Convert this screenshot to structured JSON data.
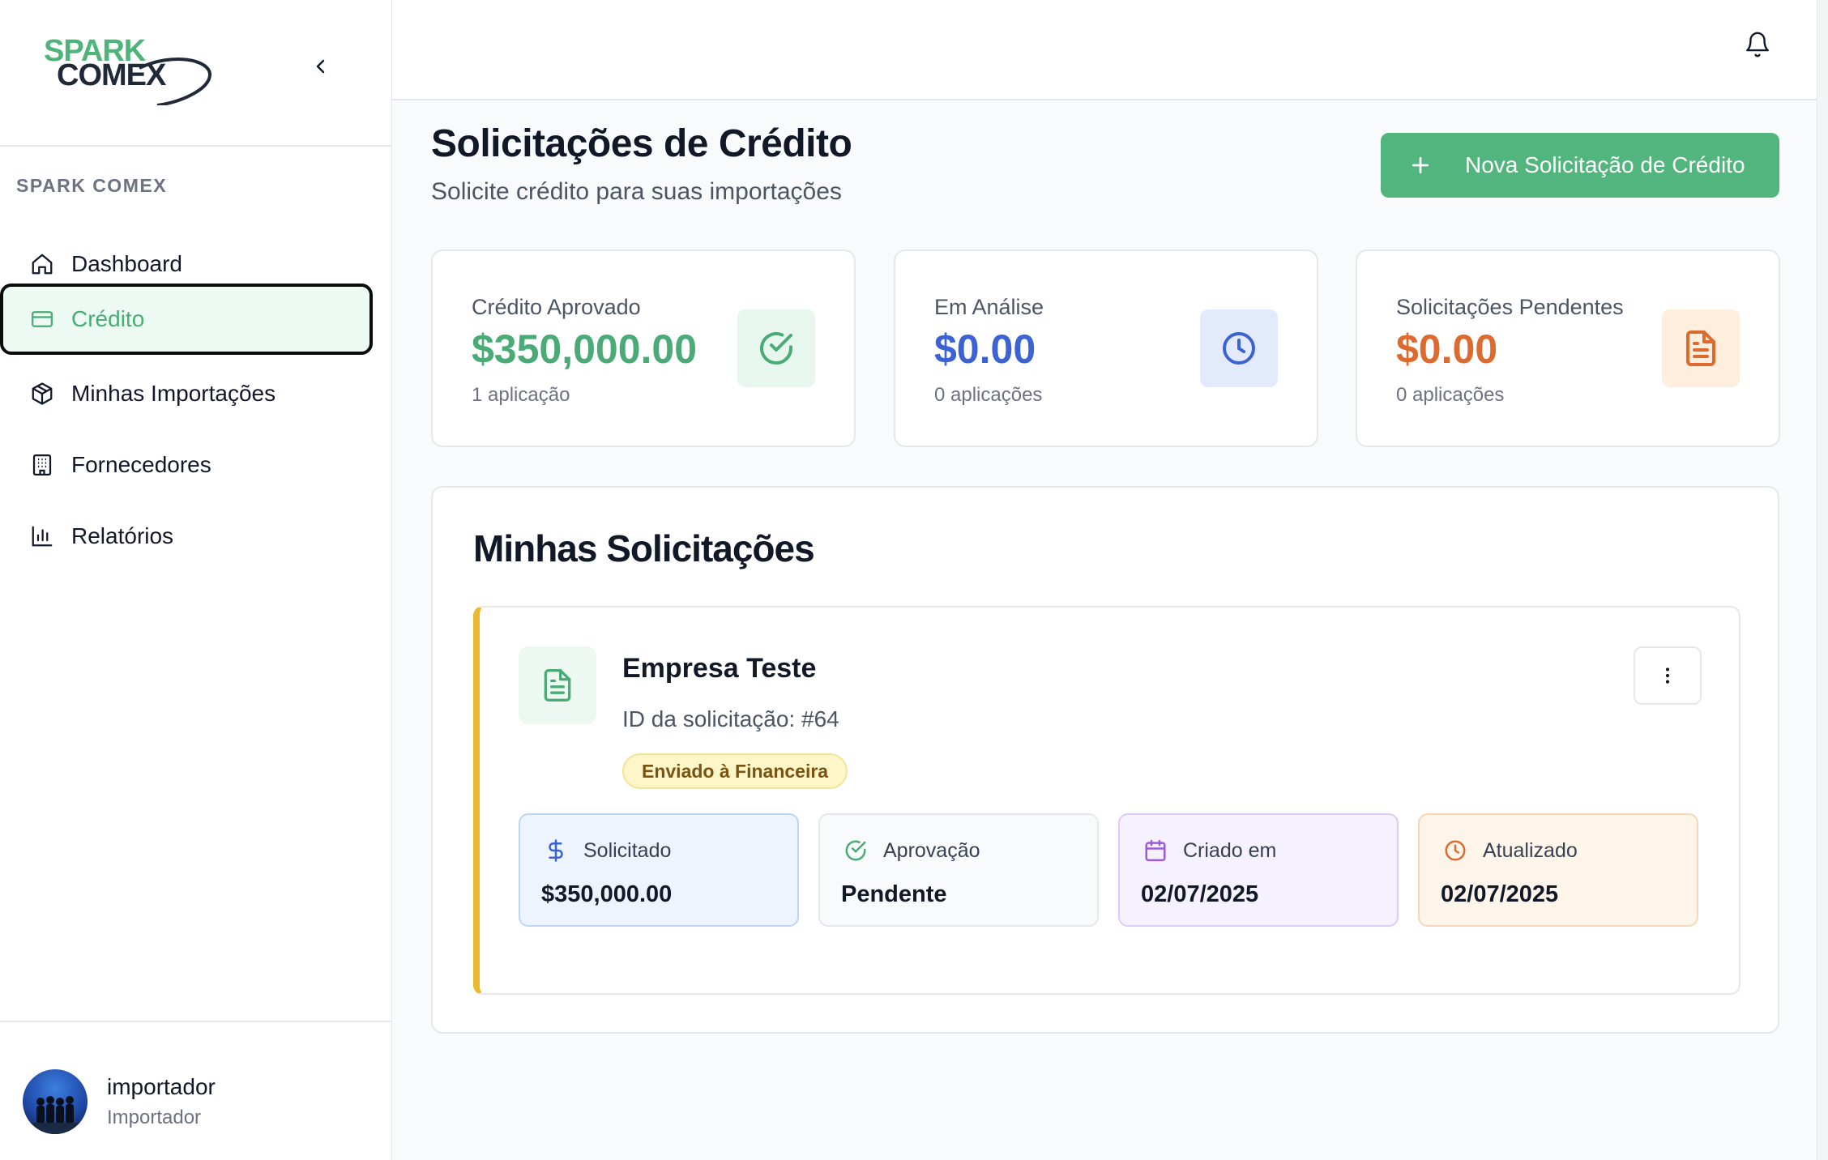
{
  "app": {
    "logo_line1": "SPARK",
    "logo_line2": "COMEX",
    "section_label": "SPARK COMEX"
  },
  "sidebar": {
    "items": [
      {
        "label": "Dashboard",
        "icon": "home-icon",
        "active": false
      },
      {
        "label": "Crédito",
        "icon": "credit-card-icon",
        "active": true
      },
      {
        "label": "Minhas Importações",
        "icon": "package-icon",
        "active": false
      },
      {
        "label": "Fornecedores",
        "icon": "building-icon",
        "active": false
      },
      {
        "label": "Relatórios",
        "icon": "bar-chart-icon",
        "active": false
      }
    ]
  },
  "user": {
    "name": "importador",
    "role": "Importador"
  },
  "header": {
    "title": "Solicitações de Crédito",
    "subtitle": "Solicite crédito para suas importações",
    "new_button": "Nova Solicitação de Crédito"
  },
  "stats": [
    {
      "label": "Crédito Aprovado",
      "value": "$350,000.00",
      "sub": "1 aplicação",
      "color": "#4aab76",
      "icon": "check-circle-icon"
    },
    {
      "label": "Em Análise",
      "value": "$0.00",
      "sub": "0 aplicações",
      "color": "#3b63d4",
      "icon": "clock-icon"
    },
    {
      "label": "Solicitações Pendentes",
      "value": "$0.00",
      "sub": "0 aplicações",
      "color": "#dd6a2e",
      "icon": "file-text-icon"
    }
  ],
  "requests": {
    "title": "Minhas Solicitações",
    "items": [
      {
        "company": "Empresa Teste",
        "id_text": "ID da solicitação: #64",
        "status": "Enviado à Financeira",
        "fields": [
          {
            "label": "Solicitado",
            "value": "$350,000.00",
            "icon": "dollar-icon"
          },
          {
            "label": "Aprovação",
            "value": "Pendente",
            "icon": "check-circle-icon"
          },
          {
            "label": "Criado em",
            "value": "02/07/2025",
            "icon": "calendar-icon"
          },
          {
            "label": "Atualizado",
            "value": "02/07/2025",
            "icon": "clock-icon"
          }
        ]
      }
    ]
  }
}
